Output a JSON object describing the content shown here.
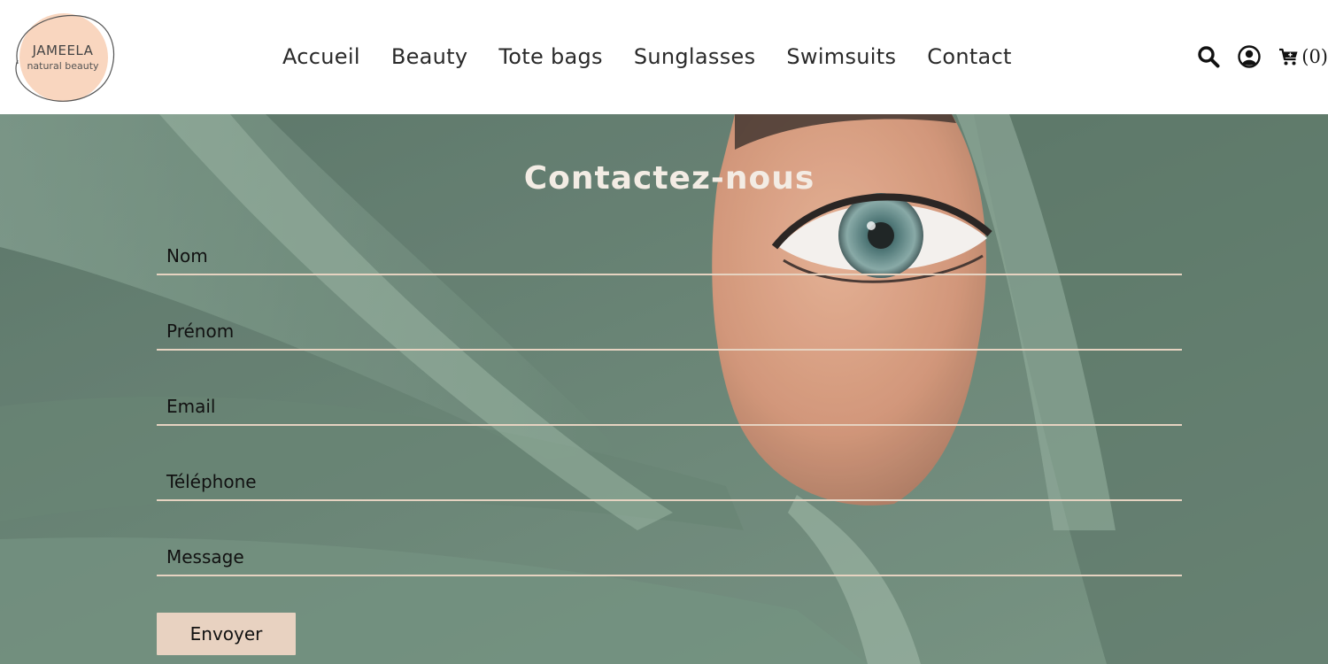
{
  "brand": {
    "name": "JAMEELA",
    "tagline": "natural beauty",
    "accent": "#f9d6bf"
  },
  "nav": {
    "items": [
      {
        "label": "Accueil"
      },
      {
        "label": "Beauty"
      },
      {
        "label": "Tote bags"
      },
      {
        "label": "Sunglasses"
      },
      {
        "label": "Swimsuits"
      },
      {
        "label": "Contact"
      }
    ]
  },
  "header_icons": {
    "search": "search-icon",
    "account": "user-icon",
    "cart": "cart-icon",
    "cart_count": "(0)"
  },
  "contact": {
    "title": "Contactez-nous",
    "fields": [
      {
        "label": "Nom"
      },
      {
        "label": "Prénom"
      },
      {
        "label": "Email"
      },
      {
        "label": "Téléphone"
      },
      {
        "label": "Message"
      }
    ],
    "submit_label": "Envoyer"
  },
  "colors": {
    "field_line": "#e6d3c1",
    "button_bg": "#e8d2c1",
    "title_color": "#f3ece4"
  }
}
